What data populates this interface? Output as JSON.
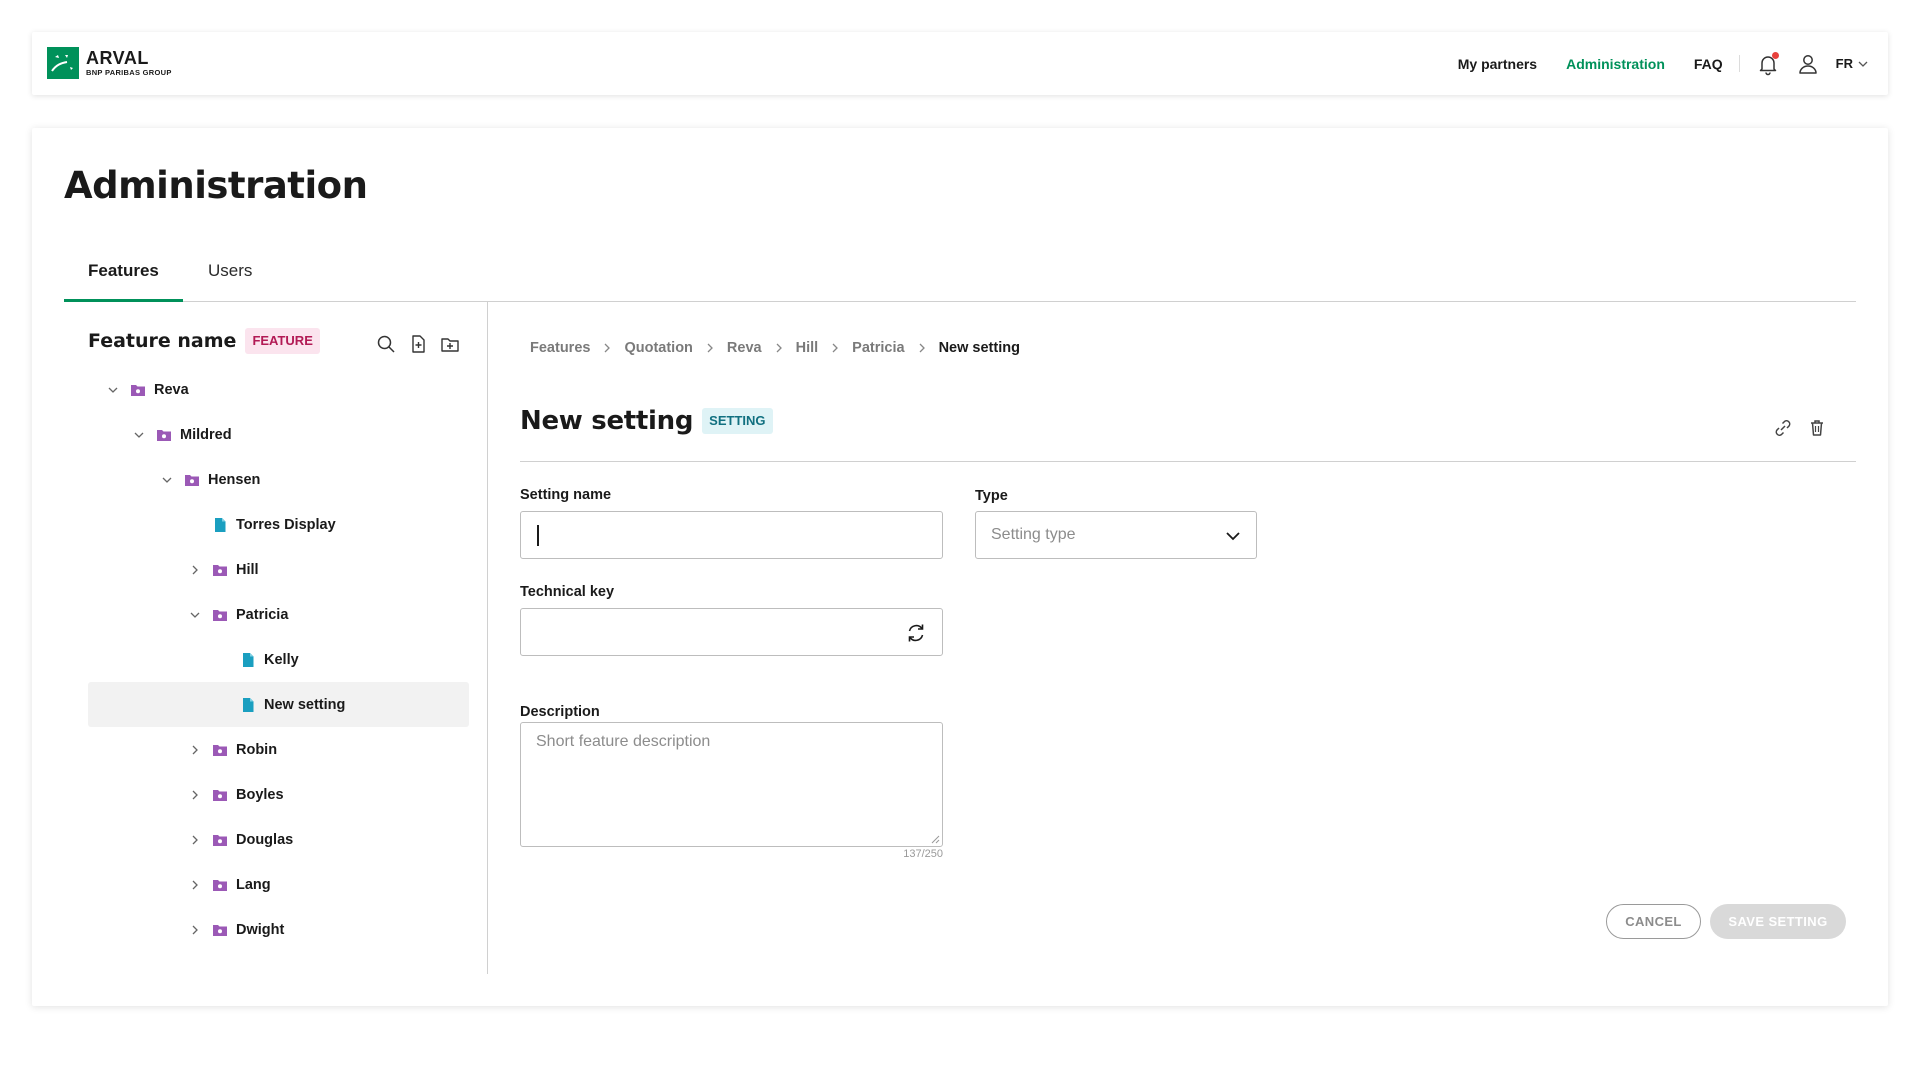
{
  "brand": {
    "name": "ARVAL",
    "group": "BNP PARIBAS GROUP",
    "color": "#00915a"
  },
  "topnav": {
    "links": [
      "My partners",
      "Administration",
      "FAQ"
    ],
    "active": "Administration",
    "language": "FR",
    "icons": [
      "bell-icon",
      "user-icon",
      "chevron-down-icon"
    ]
  },
  "page": {
    "title": "Administration"
  },
  "tabs": [
    {
      "label": "Features",
      "active": true
    },
    {
      "label": "Users",
      "active": false
    }
  ],
  "tree": {
    "title": "Feature name",
    "badge": "FEATURE",
    "tools": [
      "search-icon",
      "new-file-icon",
      "new-folder-icon"
    ],
    "nodes": [
      {
        "label": "Reva",
        "type": "folder",
        "expanded": true,
        "level": 0
      },
      {
        "label": "Mildred",
        "type": "folder",
        "expanded": true,
        "level": 1
      },
      {
        "label": "Hensen",
        "type": "folder",
        "expanded": true,
        "level": 2
      },
      {
        "label": "Torres Display",
        "type": "file",
        "level": 3
      },
      {
        "label": "Hill",
        "type": "folder",
        "expanded": false,
        "level": 3
      },
      {
        "label": "Patricia",
        "type": "folder",
        "expanded": true,
        "level": 3
      },
      {
        "label": "Kelly",
        "type": "file",
        "level": 4
      },
      {
        "label": "New setting",
        "type": "file",
        "level": 4,
        "selected": true
      },
      {
        "label": "Robin",
        "type": "folder",
        "expanded": false,
        "level": 3
      },
      {
        "label": "Boyles",
        "type": "folder",
        "expanded": false,
        "level": 3
      },
      {
        "label": "Douglas",
        "type": "folder",
        "expanded": false,
        "level": 3
      },
      {
        "label": "Lang",
        "type": "folder",
        "expanded": false,
        "level": 3
      },
      {
        "label": "Dwight",
        "type": "folder",
        "expanded": false,
        "level": 3
      }
    ]
  },
  "breadcrumb": [
    "Features",
    "Quotation",
    "Reva",
    "Hill",
    "Patricia",
    "New setting"
  ],
  "form": {
    "title": "New setting",
    "badge": "SETTING",
    "actions": [
      "link-icon",
      "trash-icon"
    ],
    "setting_name": {
      "label": "Setting name",
      "value": ""
    },
    "type": {
      "label": "Type",
      "placeholder": "Setting type"
    },
    "technical_key": {
      "label": "Technical key",
      "value": ""
    },
    "description": {
      "label": "Description",
      "placeholder": "Short feature description",
      "counter": "137/250"
    },
    "cancel_label": "CANCEL",
    "save_label": "SAVE SETTING"
  },
  "colors": {
    "accent": "#00915a",
    "folder": "#9b59b6",
    "file": "#1a9fc0",
    "notification": "#e8413c"
  }
}
